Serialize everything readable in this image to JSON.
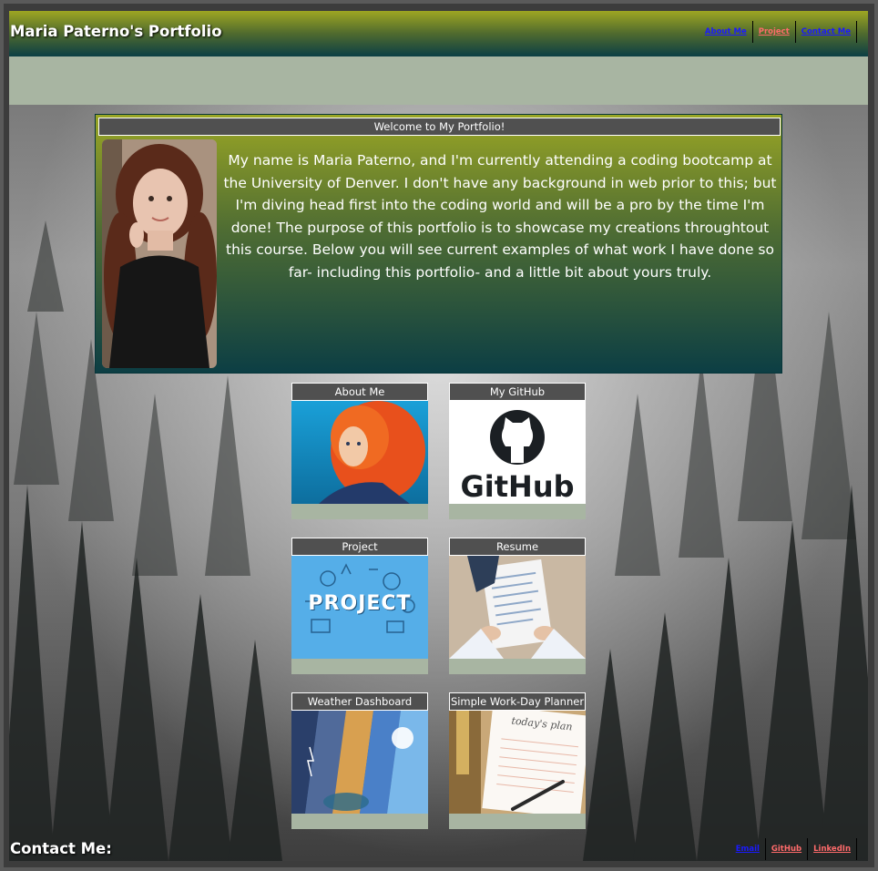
{
  "header": {
    "title": "Maria Paterno's Portfolio",
    "nav": [
      {
        "label": "About Me",
        "color": "#1a1aff"
      },
      {
        "label": "Project",
        "color": "#ff6b6b"
      },
      {
        "label": "Contact Me",
        "color": "#1a1aff"
      }
    ]
  },
  "welcome": {
    "title": "Welcome to My Portfolio!",
    "text": "My name is Maria Paterno, and I'm currently attending a coding bootcamp at the University of Denver. I don't have any background in web prior to this; but I'm diving head first into the coding world and will be a pro by the time I'm done! The purpose of this portfolio is to showcase my creations throughtout this course. Below you will see current examples of what work I have done so far- including this portfolio- and a little bit about yours truly."
  },
  "cards": [
    {
      "title": "About Me"
    },
    {
      "title": "My GitHub",
      "image_text": "GitHub"
    },
    {
      "title": "Project",
      "image_text": "PROJECT"
    },
    {
      "title": "Resume"
    },
    {
      "title": "Weather Dashboard"
    },
    {
      "title": "Simple Work-Day Planner",
      "image_text": "today's plan"
    }
  ],
  "footer": {
    "title": "Contact Me:",
    "links": [
      {
        "label": "Email",
        "color": "#1a1aff"
      },
      {
        "label": "GitHub",
        "color": "#ff6b6b"
      },
      {
        "label": "LinkedIn",
        "color": "#ff6b6b"
      }
    ]
  },
  "colors": {
    "header_gradient_top": "#9ea622",
    "header_gradient_bottom": "#0b3f45",
    "banner": "#a8b5a2",
    "card_title_bg": "#505050"
  }
}
